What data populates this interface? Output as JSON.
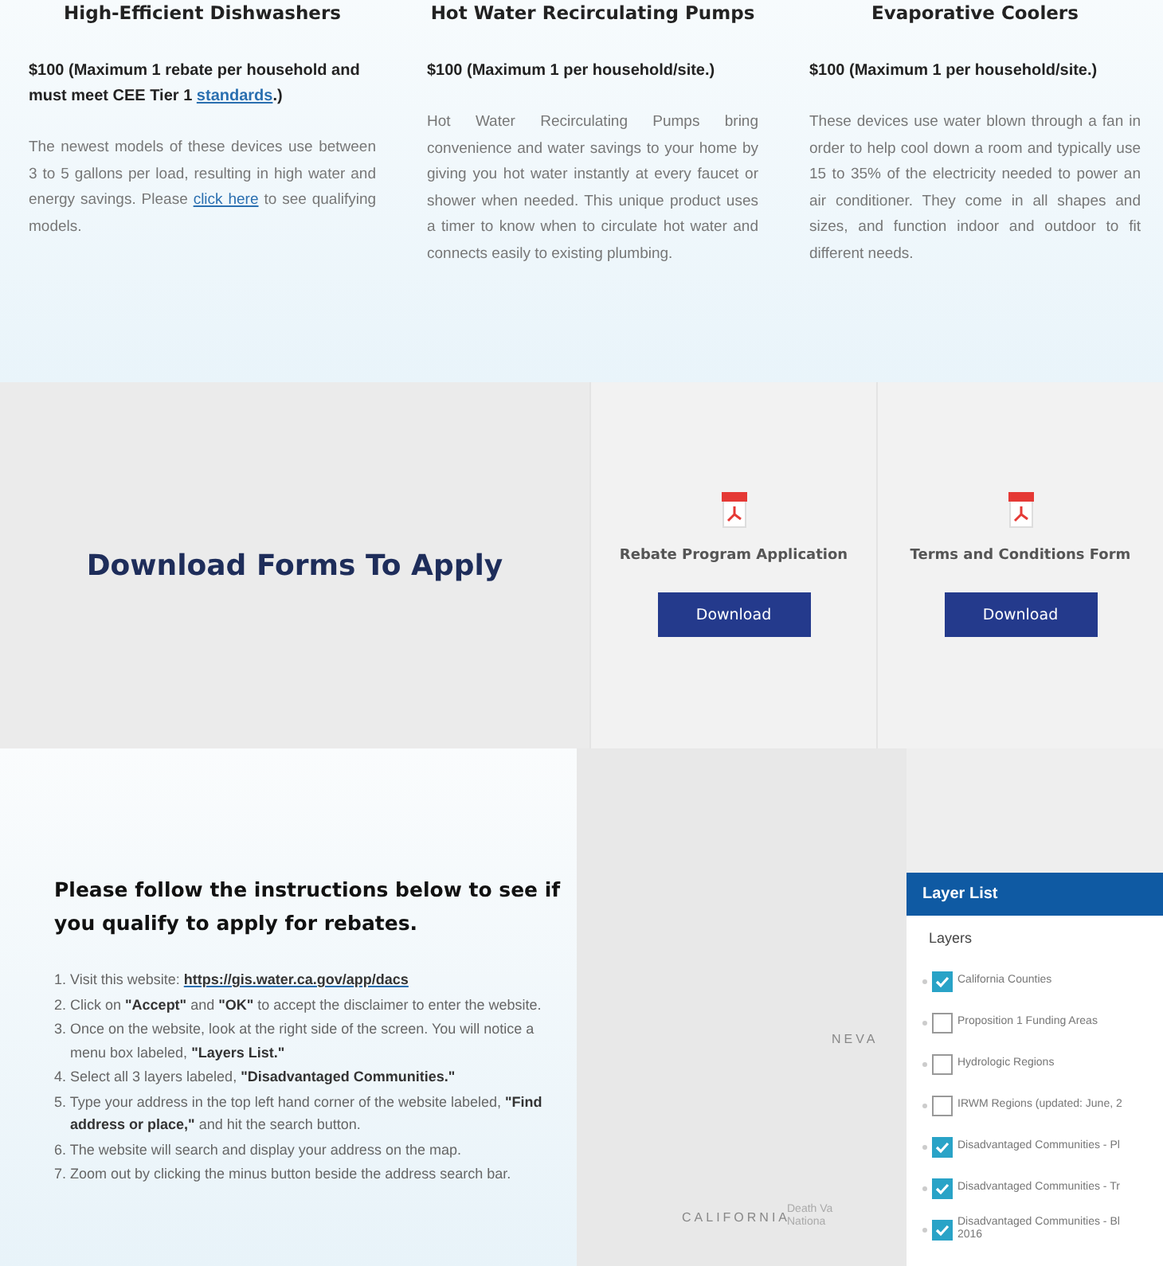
{
  "rebates": [
    {
      "title": "High-Efficient Dishwashers",
      "amount": "$100 (Maximum 1 rebate per household and must meet CEE Tier 1 ",
      "amount_link": "standards",
      "amount_end": ".)",
      "description": "The newest models of these devices use between 3 to 5 gallons per load, resulting in high water and energy savings. Please ",
      "description_link": "click here",
      "description_end": " to see qualifying models."
    },
    {
      "title": "Hot Water Recirculating Pumps",
      "amount": "$100 (Maximum 1 per household/site.)",
      "description": "Hot Water Recirculating Pumps bring convenience and water savings to your home by giving you hot water instantly at every faucet or shower when needed. This unique product uses a timer to know when to circulate hot water and connects easily to existing plumbing."
    },
    {
      "title": "Evaporative Coolers",
      "amount": "$100 (Maximum 1 per household/site.)",
      "description": "These devices use water blown through a fan in order to help cool down a room and typically use 15 to 35% of the electricity needed to power an air conditioner. They come in all shapes and sizes, and function indoor and outdoor to fit different needs."
    }
  ],
  "downloads": {
    "heading": "Download Forms To Apply",
    "forms": [
      {
        "title": "Rebate Program Application",
        "button": "Download"
      },
      {
        "title": "Terms and Conditions Form",
        "button": "Download"
      }
    ]
  },
  "instructions": {
    "heading": "Please follow the instructions below to see if you qualify to apply for rebates.",
    "steps": [
      {
        "text": "1. Visit this website: ",
        "link": "https://gis.water.ca.gov/app/dacs"
      },
      {
        "text": "2. Click on **\"Accept\"** and **\"OK\"** to accept the disclaimer to enter the website."
      },
      {
        "text": "3. Once on the website, look at the right side of the screen. You will notice a menu box labeled, **\"Layers List.\"**"
      },
      {
        "text": "4. Select all 3 layers labeled, **\"Disadvantaged Communities.\"**"
      },
      {
        "text": "5. Type your address in the top left hand corner of the website labeled, **\"Find address or place,\"** and hit the search button."
      },
      {
        "text": "6. The website will search and display your address on the map."
      },
      {
        "text": "7. Zoom out by clicking the minus button beside the address search bar."
      }
    ]
  },
  "map": {
    "labels": [
      "NEVA",
      "CALIFORNIA",
      "Death Va\nNationa"
    ],
    "layer_list": {
      "title": "Layer List",
      "subtitle": "Layers",
      "layers": [
        {
          "label": "California Counties",
          "checked": true
        },
        {
          "label": "Proposition 1 Funding Areas",
          "checked": false
        },
        {
          "label": "Hydrologic Regions",
          "checked": false
        },
        {
          "label": "IRWM Regions (updated: June, 2",
          "checked": false
        },
        {
          "label": "Disadvantaged Communities - Pl",
          "checked": true
        },
        {
          "label": "Disadvantaged Communities - Tr",
          "checked": true
        },
        {
          "label": "Disadvantaged Communities - Bl\n2016",
          "checked": true
        }
      ]
    }
  }
}
